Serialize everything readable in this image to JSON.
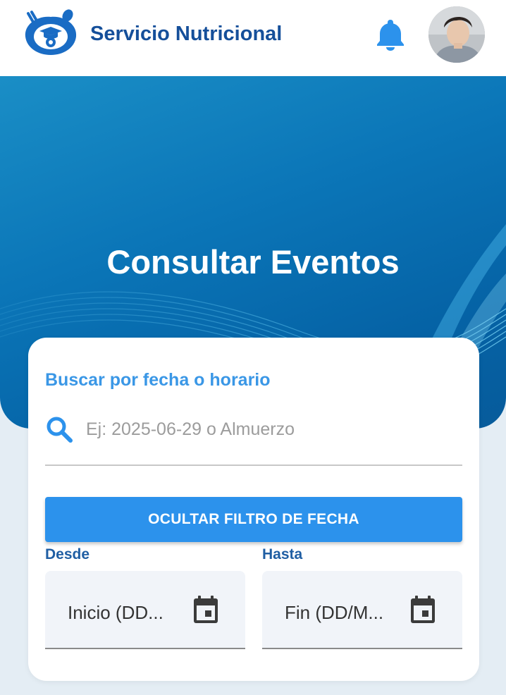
{
  "header": {
    "app_title": "Servicio Nutricional",
    "logo_icon": "fork-spoon-graduation-cap-logo-icon",
    "notification_icon": "bell-icon",
    "avatar_icon": "user-avatar"
  },
  "hero": {
    "title": "Consultar Eventos"
  },
  "search": {
    "label": "Buscar por fecha o horario",
    "placeholder": "Ej: 2025-06-29 o Almuerzo",
    "value": "",
    "icon": "search-icon"
  },
  "date_filter": {
    "toggle_label": "OCULTAR FILTRO DE FECHA",
    "from_label": "Desde",
    "to_label": "Hasta",
    "from_placeholder": "Inicio (DD...",
    "to_placeholder": "Fin (DD/M...",
    "calendar_icon": "calendar-icon"
  },
  "colors": {
    "brand_dark": "#154f9a",
    "accent_blue": "#2c92ec",
    "label_blue": "#3a97e6",
    "hero_blue": "#0b76b8",
    "page_bg": "#e4edf4"
  }
}
